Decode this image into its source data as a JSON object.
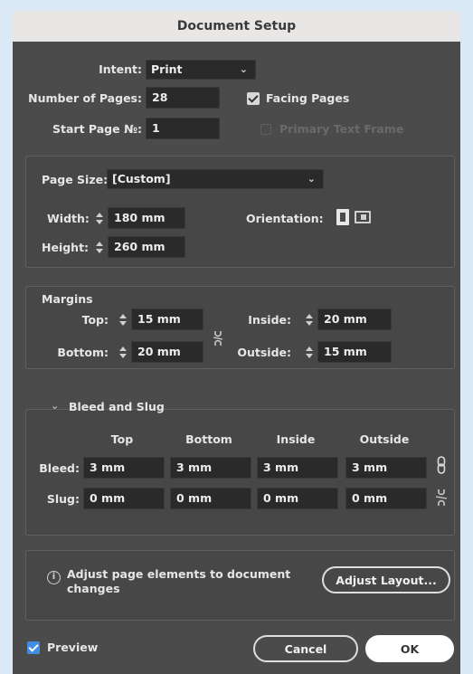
{
  "window": {
    "title": "Document Setup"
  },
  "intent": {
    "label": "Intent:",
    "value": "Print"
  },
  "pages": {
    "label": "Number of Pages:",
    "value": "28"
  },
  "start_page": {
    "label": "Start Page №:",
    "value": "1"
  },
  "facing_pages": {
    "label": "Facing Pages",
    "checked": true
  },
  "primary_text_frame": {
    "label": "Primary Text Frame",
    "checked": false,
    "enabled": false
  },
  "page_size": {
    "label": "Page Size:",
    "value": "[Custom]",
    "width_label": "Width:",
    "width": "180 mm",
    "height_label": "Height:",
    "height": "260 mm",
    "orientation_label": "Orientation:"
  },
  "margins": {
    "title": "Margins",
    "top_label": "Top:",
    "top": "15 mm",
    "bottom_label": "Bottom:",
    "bottom": "20 mm",
    "inside_label": "Inside:",
    "inside": "20 mm",
    "outside_label": "Outside:",
    "outside": "15 mm"
  },
  "bleed_slug": {
    "title": "Bleed and Slug",
    "headers": [
      "Top",
      "Bottom",
      "Inside",
      "Outside"
    ],
    "bleed_label": "Bleed:",
    "bleed": [
      "3 mm",
      "3 mm",
      "3 mm",
      "3 mm"
    ],
    "slug_label": "Slug:",
    "slug": [
      "0 mm",
      "0 mm",
      "0 mm",
      "0 mm"
    ]
  },
  "adjust": {
    "message": "Adjust page elements to document changes",
    "button": "Adjust Layout..."
  },
  "preview": {
    "label": "Preview",
    "checked": true
  },
  "buttons": {
    "cancel": "Cancel",
    "ok": "OK"
  },
  "colors": {
    "dialog_bg": "#4b4b4b",
    "field_bg": "#2a2a2a",
    "accent": "#3f8ee0",
    "backdrop": "#dbe8f6"
  }
}
